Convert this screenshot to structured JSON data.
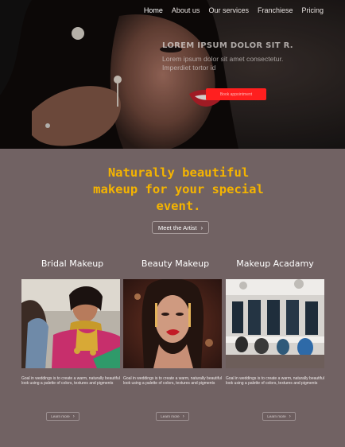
{
  "nav": {
    "items": [
      {
        "label": "Home",
        "active": true
      },
      {
        "label": "About us",
        "active": false
      },
      {
        "label": "Our services",
        "active": false
      },
      {
        "label": "Franchiese",
        "active": false
      },
      {
        "label": "Pricing",
        "active": false
      }
    ]
  },
  "hero": {
    "title": "LOREM IPSUM DOLOR SIT R.",
    "subtitle": "Lorem ipsum dolor sit amet consectetur. Imperdiet tortor id",
    "button_label": "Book appointment"
  },
  "headline": {
    "text": "Naturally beautiful makeup for your special event.",
    "color": "#f5b400"
  },
  "artist_button": {
    "label": "Meet the Artist",
    "icon": "chevron-right-icon"
  },
  "services": [
    {
      "title": "Bridal Makeup",
      "description": "Goal in weddings is to create a warm, naturally beautiful look using a palette of colors, textures and pigments",
      "button_label": "Learn more"
    },
    {
      "title": "Beauty Makeup",
      "description": "Goal in weddings is to create a warm, naturally beautiful look using a palette of colors, textures and pigments",
      "button_label": "Learn more"
    },
    {
      "title": "Makeup Acadamy",
      "description": "Goal in weddings is to create a warm, naturally beautiful look using a palette of colors, textures and pigments",
      "button_label": "Learn more"
    }
  ],
  "colors": {
    "page_bg": "#716263",
    "hero_button": "#ff1f1f",
    "accent": "#f5b400"
  }
}
